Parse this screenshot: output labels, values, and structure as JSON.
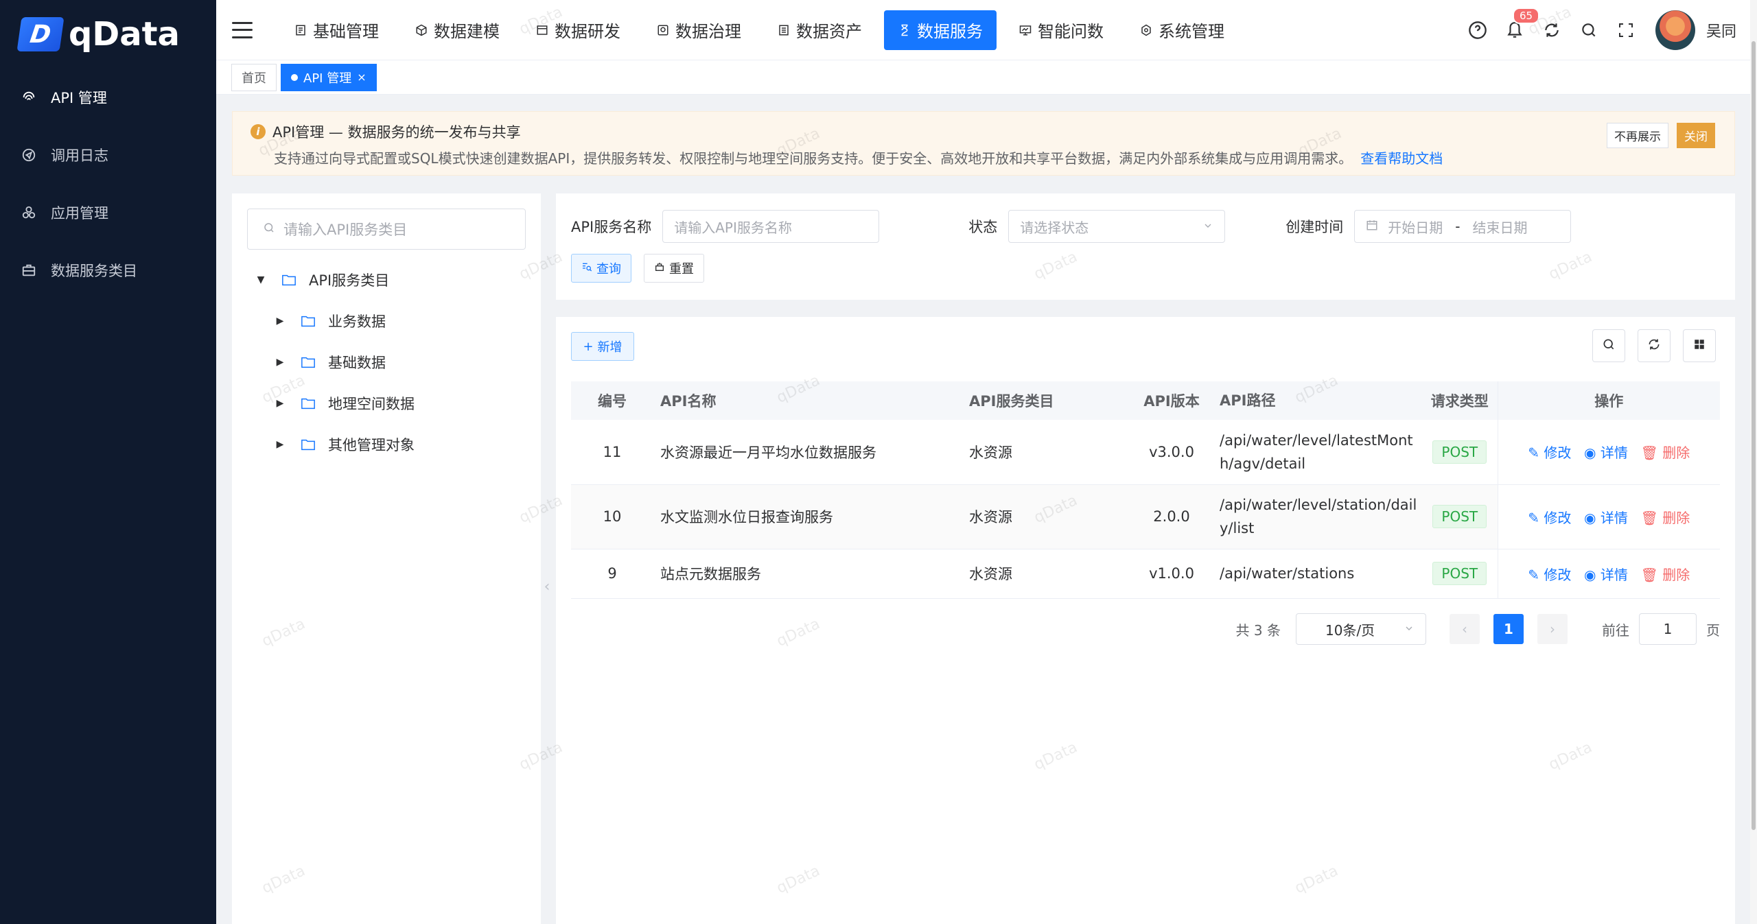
{
  "app": {
    "logo_text": "qData",
    "logo_mark": "D"
  },
  "sidebar": {
    "items": [
      {
        "label": "API 管理",
        "icon": "fingerprint-icon"
      },
      {
        "label": "调用日志",
        "icon": "send-icon"
      },
      {
        "label": "应用管理",
        "icon": "apps-icon"
      },
      {
        "label": "数据服务类目",
        "icon": "briefcase-icon"
      }
    ]
  },
  "topnav": {
    "tabs": [
      {
        "label": "基础管理"
      },
      {
        "label": "数据建模"
      },
      {
        "label": "数据研发"
      },
      {
        "label": "数据治理"
      },
      {
        "label": "数据资产"
      },
      {
        "label": "数据服务"
      },
      {
        "label": "智能问数"
      },
      {
        "label": "系统管理"
      }
    ],
    "notification_count": "65",
    "username": "吴同"
  },
  "tabsbar": {
    "home": "首页",
    "current": "API 管理"
  },
  "notice": {
    "title": "API管理 — 数据服务的统一发布与共享",
    "desc": "支持通过向导式配置或SQL模式快速创建数据API，提供服务转发、权限控制与地理空间服务支持。便于安全、高效地开放和共享平台数据，满足内外部系统集成与应用调用需求。",
    "link": "查看帮助文档",
    "dismiss": "不再展示",
    "close": "关闭"
  },
  "tree": {
    "search_placeholder": "请输入API服务类目",
    "root": "API服务类目",
    "children": [
      "业务数据",
      "基础数据",
      "地理空间数据",
      "其他管理对象"
    ]
  },
  "filters": {
    "name_label": "API服务名称",
    "name_placeholder": "请输入API服务名称",
    "status_label": "状态",
    "status_placeholder": "请选择状态",
    "time_label": "创建时间",
    "start_placeholder": "开始日期",
    "separator": "-",
    "end_placeholder": "结束日期",
    "query": "查询",
    "reset": "重置"
  },
  "table": {
    "add": "新增",
    "headers": {
      "id": "编号",
      "name": "API名称",
      "category": "API服务类目",
      "version": "API版本",
      "path": "API路径",
      "type": "请求类型",
      "ops": "操作"
    },
    "rows": [
      {
        "id": "11",
        "name": "水资源最近一月平均水位数据服务",
        "category": "水资源",
        "version": "v3.0.0",
        "path": "/api/water/level/latestMonth/agv/detail",
        "type": "POST"
      },
      {
        "id": "10",
        "name": "水文监测水位日报查询服务",
        "category": "水资源",
        "version": "2.0.0",
        "path": "/api/water/level/station/daily/list",
        "type": "POST"
      },
      {
        "id": "9",
        "name": "站点元数据服务",
        "category": "水资源",
        "version": "v1.0.0",
        "path": "/api/water/stations",
        "type": "POST"
      }
    ],
    "ops": {
      "edit": "修改",
      "detail": "详情",
      "delete": "删除"
    }
  },
  "pager": {
    "total": "共 3 条",
    "size": "10条/页",
    "current": "1",
    "goto": "前往",
    "goto_value": "1",
    "page_unit": "页"
  },
  "watermark": "qData",
  "colors": {
    "primary": "#1677ff",
    "sidebar_bg": "#0f1a2e",
    "danger": "#f56c6c",
    "success": "#29a745",
    "warning": "#e6a23c"
  }
}
